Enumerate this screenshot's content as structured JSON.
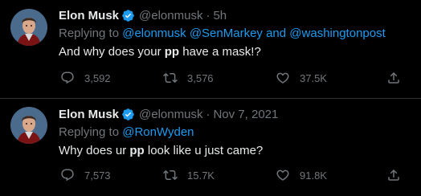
{
  "colors": {
    "background": "#000000",
    "text": "#e7e9ea",
    "muted": "#71767b",
    "link": "#1d9bf0",
    "verified_badge": "#1d9bf0",
    "divider": "#2f3336"
  },
  "tweets": [
    {
      "author_name": "Elon Musk",
      "handle": "@elonmusk",
      "separator": "·",
      "time": "5h",
      "replying_prefix": "Replying to",
      "mentions": [
        "@elonmusk",
        "@SenMarkey"
      ],
      "mentions_joiner": "and",
      "mentions_last": "@washingtonpost",
      "text_before": "And why does your",
      "text_bold": "pp",
      "text_after": "have a mask!?",
      "stats": {
        "replies": "3,592",
        "retweets": "3,576",
        "likes": "37.5K"
      },
      "icons": [
        "reply-icon",
        "retweet-icon",
        "like-icon",
        "share-icon"
      ]
    },
    {
      "author_name": "Elon Musk",
      "handle": "@elonmusk",
      "separator": "·",
      "time": "Nov 7, 2021",
      "replying_prefix": "Replying to",
      "mentions": [
        "@RonWyden"
      ],
      "text_before": "Why does ur",
      "text_bold": "pp",
      "text_after": "look like u just came?",
      "stats": {
        "replies": "7,573",
        "retweets": "15.7K",
        "likes": "91.8K"
      },
      "icons": [
        "reply-icon",
        "retweet-icon",
        "like-icon",
        "share-icon"
      ]
    }
  ]
}
